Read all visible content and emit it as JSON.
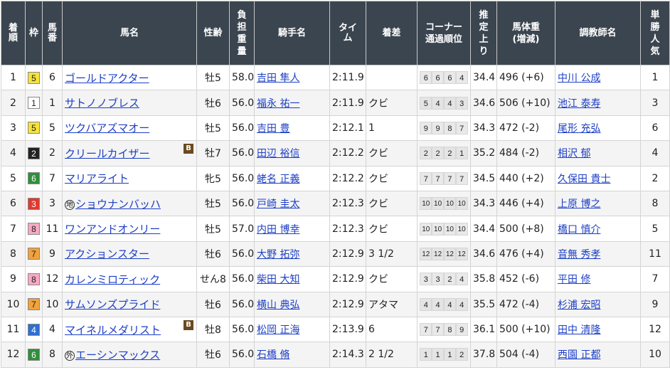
{
  "headers": {
    "rank": [
      "着",
      "順"
    ],
    "waku": "枠",
    "umaban": [
      "馬",
      "番"
    ],
    "horse": "馬名",
    "sexage": "性齢",
    "weight": [
      "負",
      "担",
      "重",
      "量"
    ],
    "jockey": "騎手名",
    "time": [
      "タ",
      "イ",
      "ム"
    ],
    "margin": "着差",
    "corner": [
      "コーナー",
      "通過順位"
    ],
    "last": [
      "推",
      "定",
      "上",
      "り"
    ],
    "body": [
      "馬体重",
      "(増減)"
    ],
    "trainer": "調教師名",
    "pop": [
      "単",
      "勝",
      "人",
      "気"
    ]
  },
  "colors": {
    "header_bg": "#3b4550",
    "link": "#1d3fc6",
    "waku": {
      "1": {
        "bg": "#ffffff",
        "fg": "#222222"
      },
      "2": {
        "bg": "#222222",
        "fg": "#ffffff"
      },
      "3": {
        "bg": "#e03a2f",
        "fg": "#ffffff"
      },
      "4": {
        "bg": "#2e6fd1",
        "fg": "#ffffff"
      },
      "5": {
        "bg": "#f5e23c",
        "fg": "#222222"
      },
      "6": {
        "bg": "#2f8f3a",
        "fg": "#ffffff"
      },
      "7": {
        "bg": "#f2a23a",
        "fg": "#222222"
      },
      "8": {
        "bg": "#f6a9c4",
        "fg": "#222222"
      }
    }
  },
  "rows": [
    {
      "rank": "1",
      "waku": "5",
      "umaban": "6",
      "mark": "",
      "horse": "ゴールドアクター",
      "blinker": false,
      "sexage": "牡5",
      "weight": "58.0",
      "jockey": "吉田 隼人",
      "time": "2:11.9",
      "margin": "",
      "corner": [
        "6",
        "6",
        "6",
        "4"
      ],
      "last": "34.4",
      "body": "496 (+6)",
      "trainer": "中川 公成",
      "pop": "1"
    },
    {
      "rank": "2",
      "waku": "1",
      "umaban": "1",
      "mark": "",
      "horse": "サトノノブレス",
      "blinker": false,
      "sexage": "牡6",
      "weight": "56.0",
      "jockey": "福永 祐一",
      "time": "2:11.9",
      "margin": "クビ",
      "corner": [
        "5",
        "4",
        "4",
        "3"
      ],
      "last": "34.6",
      "body": "506 (+10)",
      "trainer": "池江 泰寿",
      "pop": "3"
    },
    {
      "rank": "3",
      "waku": "5",
      "umaban": "5",
      "mark": "",
      "horse": "ツクバアズマオー",
      "blinker": false,
      "sexage": "牡5",
      "weight": "56.0",
      "jockey": "吉田 豊",
      "time": "2:12.1",
      "margin": "1",
      "corner": [
        "9",
        "9",
        "8",
        "7"
      ],
      "last": "34.3",
      "body": "472 (-2)",
      "trainer": "尾形 充弘",
      "pop": "6"
    },
    {
      "rank": "4",
      "waku": "2",
      "umaban": "2",
      "mark": "",
      "horse": "クリールカイザー",
      "blinker": true,
      "sexage": "牡7",
      "weight": "56.0",
      "jockey": "田辺 裕信",
      "time": "2:12.2",
      "margin": "クビ",
      "corner": [
        "2",
        "2",
        "2",
        "1"
      ],
      "last": "35.2",
      "body": "484 (-2)",
      "trainer": "相沢 郁",
      "pop": "4"
    },
    {
      "rank": "5",
      "waku": "6",
      "umaban": "7",
      "mark": "",
      "horse": "マリアライト",
      "blinker": false,
      "sexage": "牝5",
      "weight": "56.0",
      "jockey": "蛯名 正義",
      "time": "2:12.2",
      "margin": "クビ",
      "corner": [
        "7",
        "7",
        "7",
        "7"
      ],
      "last": "34.5",
      "body": "440 (+2)",
      "trainer": "久保田 貴士",
      "pop": "2"
    },
    {
      "rank": "6",
      "waku": "3",
      "umaban": "3",
      "mark": "地",
      "horse": "ショウナンバッハ",
      "blinker": false,
      "sexage": "牡5",
      "weight": "56.0",
      "jockey": "戸崎 圭太",
      "time": "2:12.3",
      "margin": "クビ",
      "corner": [
        "10",
        "10",
        "10",
        "10"
      ],
      "last": "34.3",
      "body": "446 (+4)",
      "trainer": "上原 博之",
      "pop": "8"
    },
    {
      "rank": "7",
      "waku": "8",
      "umaban": "11",
      "mark": "",
      "horse": "ワンアンドオンリー",
      "blinker": false,
      "sexage": "牡5",
      "weight": "57.0",
      "jockey": "内田 博幸",
      "time": "2:12.3",
      "margin": "クビ",
      "corner": [
        "10",
        "10",
        "10",
        "10"
      ],
      "last": "34.4",
      "body": "500 (+8)",
      "trainer": "橋口 慎介",
      "pop": "5"
    },
    {
      "rank": "8",
      "waku": "7",
      "umaban": "9",
      "mark": "",
      "horse": "アクションスター",
      "blinker": false,
      "sexage": "牡6",
      "weight": "56.0",
      "jockey": "大野 拓弥",
      "time": "2:12.9",
      "margin": "3 1/2",
      "corner": [
        "12",
        "12",
        "12",
        "12"
      ],
      "last": "34.6",
      "body": "476 (+4)",
      "trainer": "音無 秀孝",
      "pop": "11"
    },
    {
      "rank": "9",
      "waku": "8",
      "umaban": "12",
      "mark": "",
      "horse": "カレンミロティック",
      "blinker": false,
      "sexage": "せん8",
      "weight": "56.0",
      "jockey": "柴田 大知",
      "time": "2:12.9",
      "margin": "クビ",
      "corner": [
        "3",
        "3",
        "2",
        "4"
      ],
      "last": "35.8",
      "body": "452 (-6)",
      "trainer": "平田 修",
      "pop": "7"
    },
    {
      "rank": "10",
      "waku": "7",
      "umaban": "10",
      "mark": "",
      "horse": "サムソンズプライド",
      "blinker": false,
      "sexage": "牡6",
      "weight": "56.0",
      "jockey": "横山 典弘",
      "time": "2:12.9",
      "margin": "アタマ",
      "corner": [
        "4",
        "4",
        "4",
        "4"
      ],
      "last": "35.5",
      "body": "472 (-4)",
      "trainer": "杉浦 宏昭",
      "pop": "9"
    },
    {
      "rank": "11",
      "waku": "4",
      "umaban": "4",
      "mark": "",
      "horse": "マイネルメダリスト",
      "blinker": true,
      "sexage": "牡8",
      "weight": "56.0",
      "jockey": "松岡 正海",
      "time": "2:13.9",
      "margin": "6",
      "corner": [
        "7",
        "7",
        "8",
        "9"
      ],
      "last": "36.1",
      "body": "500 (+10)",
      "trainer": "田中 清隆",
      "pop": "12"
    },
    {
      "rank": "12",
      "waku": "6",
      "umaban": "8",
      "mark": "外",
      "horse": "エーシンマックス",
      "blinker": false,
      "sexage": "牡6",
      "weight": "56.0",
      "jockey": "石橋 脩",
      "time": "2:14.3",
      "margin": "2 1/2",
      "corner": [
        "1",
        "1",
        "1",
        "2"
      ],
      "last": "37.8",
      "body": "504 (-4)",
      "trainer": "西園 正都",
      "pop": "10"
    }
  ]
}
